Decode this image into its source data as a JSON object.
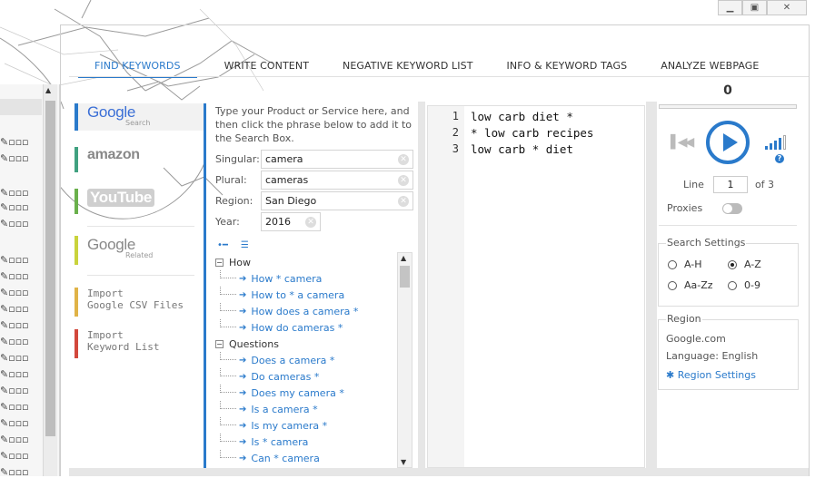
{
  "tabs": [
    "FIND KEYWORDS",
    "WRITE CONTENT",
    "NEGATIVE KEYWORD LIST",
    "INFO & KEYWORD TAGS",
    "ANALYZE WEBPAGE"
  ],
  "sources": {
    "google_search": {
      "logo": "Google",
      "sub": "Search"
    },
    "amazon": {
      "logo": "amazon"
    },
    "youtube": {
      "logo": "YouTube"
    },
    "google_related": {
      "logo": "Google",
      "sub": "Related"
    },
    "import_csv": {
      "line1": "Import",
      "line2": "Google CSV Files"
    },
    "import_list": {
      "line1": "Import",
      "line2": "Keyword List"
    }
  },
  "phrase": {
    "instructions": "Type your Product or Service here, and then click the phrase below to add it to the Search Box.",
    "fields": {
      "singular": {
        "label": "Singular:",
        "value": "camera"
      },
      "plural": {
        "label": "Plural:",
        "value": "cameras"
      },
      "region": {
        "label": "Region:",
        "value": "San Diego"
      },
      "year": {
        "label": "Year:",
        "value": "2016"
      }
    },
    "groups": [
      {
        "label": "How",
        "items": [
          "How * camera",
          "How to * a camera",
          "How does a camera *",
          "How do cameras *"
        ]
      },
      {
        "label": "Questions",
        "items": [
          "Does a camera *",
          "Do cameras *",
          "Does my camera *",
          "Is a camera *",
          "Is my camera *",
          "Is * camera",
          "Can * camera"
        ]
      }
    ]
  },
  "editor": {
    "lines": [
      {
        "num": "1",
        "text": "low carb diet *"
      },
      {
        "num": "2",
        "text": "* low carb recipes"
      },
      {
        "num": "3",
        "text": "low carb * diet"
      }
    ]
  },
  "right": {
    "count": "0",
    "line_label": "Line",
    "line_value": "1",
    "of_label": "of 3",
    "proxies_label": "Proxies",
    "search_settings": {
      "legend": "Search Settings",
      "options": [
        "A-H",
        "A-Z",
        "Aa-Zz",
        "0-9"
      ],
      "selected": "A-Z"
    },
    "region": {
      "legend": "Region",
      "site": "Google.com",
      "language": "Language: English",
      "settings_link": "Region Settings"
    }
  },
  "colors": {
    "accent": "#2a7acb",
    "amazon": "#40a180",
    "youtube": "#6ab04c",
    "related": "#c9d33c",
    "csv": "#e0b347",
    "list": "#d2483c"
  }
}
